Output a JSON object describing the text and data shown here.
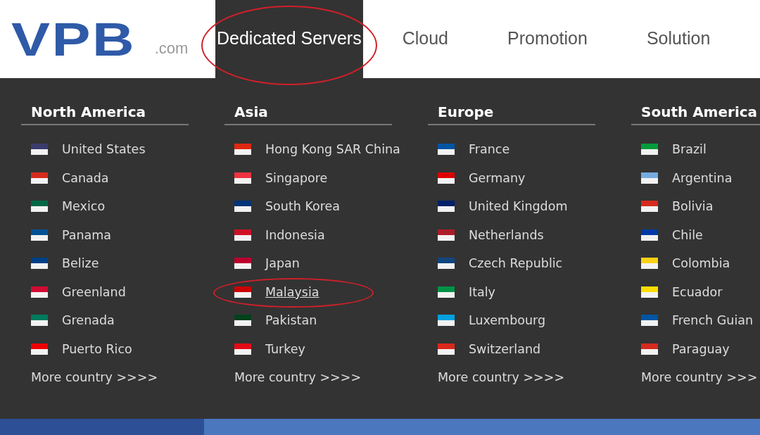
{
  "logo": {
    "mark": "VPB",
    "suffix": ".com"
  },
  "nav": [
    {
      "label": "Dedicated Servers",
      "selected": true,
      "circled": true
    },
    {
      "label": "Cloud",
      "selected": false,
      "circled": false
    },
    {
      "label": "Promotion",
      "selected": false,
      "circled": false
    },
    {
      "label": "Solution",
      "selected": false,
      "circled": false
    }
  ],
  "regions": [
    {
      "title": "North America",
      "more": "More country >>>>",
      "countries": [
        {
          "name": "United States",
          "color": "#3c3b6e",
          "selected": false,
          "circled": false
        },
        {
          "name": "Canada",
          "color": "#d52b1e",
          "selected": false,
          "circled": false
        },
        {
          "name": "Mexico",
          "color": "#006847",
          "selected": false,
          "circled": false
        },
        {
          "name": "Panama",
          "color": "#005293",
          "selected": false,
          "circled": false
        },
        {
          "name": "Belize",
          "color": "#003f87",
          "selected": false,
          "circled": false
        },
        {
          "name": "Greenland",
          "color": "#d00c33",
          "selected": false,
          "circled": false
        },
        {
          "name": "Grenada",
          "color": "#007a5e",
          "selected": false,
          "circled": false
        },
        {
          "name": "Puerto Rico",
          "color": "#ed0000",
          "selected": false,
          "circled": false
        }
      ]
    },
    {
      "title": "Asia",
      "more": "More country >>>>",
      "countries": [
        {
          "name": "Hong Kong SAR China",
          "color": "#de2910",
          "selected": false,
          "circled": false
        },
        {
          "name": "Singapore",
          "color": "#ef3340",
          "selected": false,
          "circled": false
        },
        {
          "name": "South Korea",
          "color": "#003478",
          "selected": false,
          "circled": false
        },
        {
          "name": "Indonesia",
          "color": "#ce1126",
          "selected": false,
          "circled": false
        },
        {
          "name": "Japan",
          "color": "#bc002d",
          "selected": false,
          "circled": false
        },
        {
          "name": "Malaysia",
          "color": "#cc0001",
          "selected": true,
          "circled": true
        },
        {
          "name": "Pakistan",
          "color": "#01411c",
          "selected": false,
          "circled": false
        },
        {
          "name": "Turkey",
          "color": "#e30a17",
          "selected": false,
          "circled": false
        }
      ]
    },
    {
      "title": "Europe",
      "more": "More country >>>>",
      "countries": [
        {
          "name": "France",
          "color": "#0055a4",
          "selected": false,
          "circled": false
        },
        {
          "name": "Germany",
          "color": "#dd0000",
          "selected": false,
          "circled": false
        },
        {
          "name": "United Kingdom",
          "color": "#012169",
          "selected": false,
          "circled": false
        },
        {
          "name": "Netherlands",
          "color": "#ae1c28",
          "selected": false,
          "circled": false
        },
        {
          "name": "Czech Republic",
          "color": "#11457e",
          "selected": false,
          "circled": false
        },
        {
          "name": "Italy",
          "color": "#009246",
          "selected": false,
          "circled": false
        },
        {
          "name": "Luxembourg",
          "color": "#00a1de",
          "selected": false,
          "circled": false
        },
        {
          "name": "Switzerland",
          "color": "#da291c",
          "selected": false,
          "circled": false
        }
      ]
    },
    {
      "title": "South America",
      "more": "More country >>>",
      "countries": [
        {
          "name": "Brazil",
          "color": "#009c3b",
          "selected": false,
          "circled": false
        },
        {
          "name": "Argentina",
          "color": "#74acdf",
          "selected": false,
          "circled": false
        },
        {
          "name": "Bolivia",
          "color": "#d52b1e",
          "selected": false,
          "circled": false
        },
        {
          "name": "Chile",
          "color": "#0039a6",
          "selected": false,
          "circled": false
        },
        {
          "name": "Colombia",
          "color": "#fcd116",
          "selected": false,
          "circled": false
        },
        {
          "name": "Ecuador",
          "color": "#ffdd00",
          "selected": false,
          "circled": false
        },
        {
          "name": "French Guian",
          "color": "#0055a4",
          "selected": false,
          "circled": false
        },
        {
          "name": "Paraguay",
          "color": "#d52b1e",
          "selected": false,
          "circled": false
        }
      ]
    }
  ]
}
